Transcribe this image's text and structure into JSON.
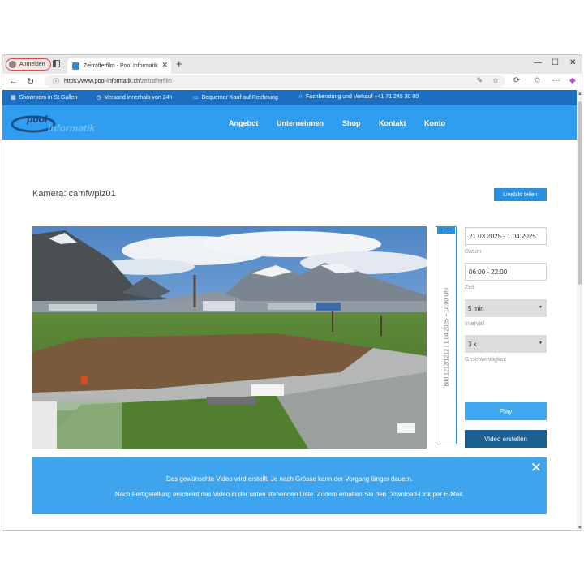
{
  "browser": {
    "profile_label": "Anmelden",
    "tab_title": "Zeitrafferfilm - Pool Informatik",
    "url_host": "https://www.pool-informatik.ch/",
    "url_path": "zeitrafferfilm"
  },
  "topbar": {
    "items": [
      {
        "label": "Showroom in St.Gallen",
        "icon": "store-icon"
      },
      {
        "label": "Versand innerhalb von 24h",
        "icon": "clock-icon"
      },
      {
        "label": "Bequemer Kauf auf Rechnung",
        "icon": "briefcase-icon"
      },
      {
        "label": "Fachberatung und Verkauf +41 71 245 30 00",
        "icon": "headset-icon"
      }
    ]
  },
  "header": {
    "logo_top": "pool",
    "logo_bottom": "informatik",
    "menu": [
      "Angebot",
      "Unternehmen",
      "Shop",
      "Kontakt",
      "Konto"
    ]
  },
  "main": {
    "camera_title": "Kamera: camfwpiz01",
    "share_label": "Livebild teilen",
    "slider_label": "Bild 1212/1212 | 1.04.2025 – 14:00 Uhr",
    "date_value": "21.03.2025 - 1.04.2025",
    "date_label": "Datum",
    "time_value": "06:00 - 22:00",
    "time_label": "Zeit",
    "interval_value": "5 min",
    "interval_label": "Intervall",
    "speed_value": "3 x",
    "speed_label": "Geschwindigkeit",
    "play_label": "Play",
    "create_label": "Video erstellen"
  },
  "notice": {
    "line1": "Das gewünschte Video wird erstellt. Je nach Grösse kann der Vorgang länger dauern.",
    "line2": "Nach Fertigstellung erscheint das Video in der unten stehenden Liste. Zudem erhalten Sie den Download-Link per E-Mail."
  },
  "colors": {
    "topbar": "#1b6fbe",
    "header": "#2f9ef0",
    "accent": "#2a90e0",
    "dark_button": "#1c5f93",
    "notice": "#3fa4ee"
  }
}
